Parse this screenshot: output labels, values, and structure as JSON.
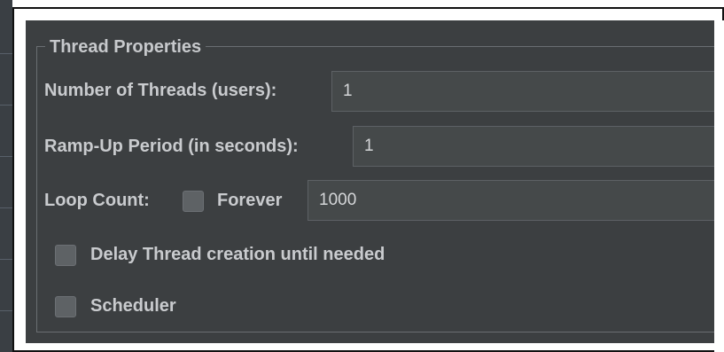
{
  "thread_properties": {
    "title": "Thread Properties",
    "num_threads": {
      "label": "Number of Threads (users):",
      "value": "1"
    },
    "ramp_up": {
      "label": "Ramp-Up Period (in seconds):",
      "value": "1"
    },
    "loop_count": {
      "label": "Loop Count:",
      "forever_label": "Forever",
      "forever_checked": false,
      "value": "1000"
    },
    "delay_thread_creation": {
      "label": "Delay Thread creation until needed",
      "checked": false
    },
    "scheduler": {
      "label": "Scheduler",
      "checked": false
    }
  },
  "colors": {
    "panel_background": "#3c3f41",
    "field_background": "#45494a",
    "label_text": "#c9cbce",
    "checkbox_fill": "#5e6265"
  }
}
